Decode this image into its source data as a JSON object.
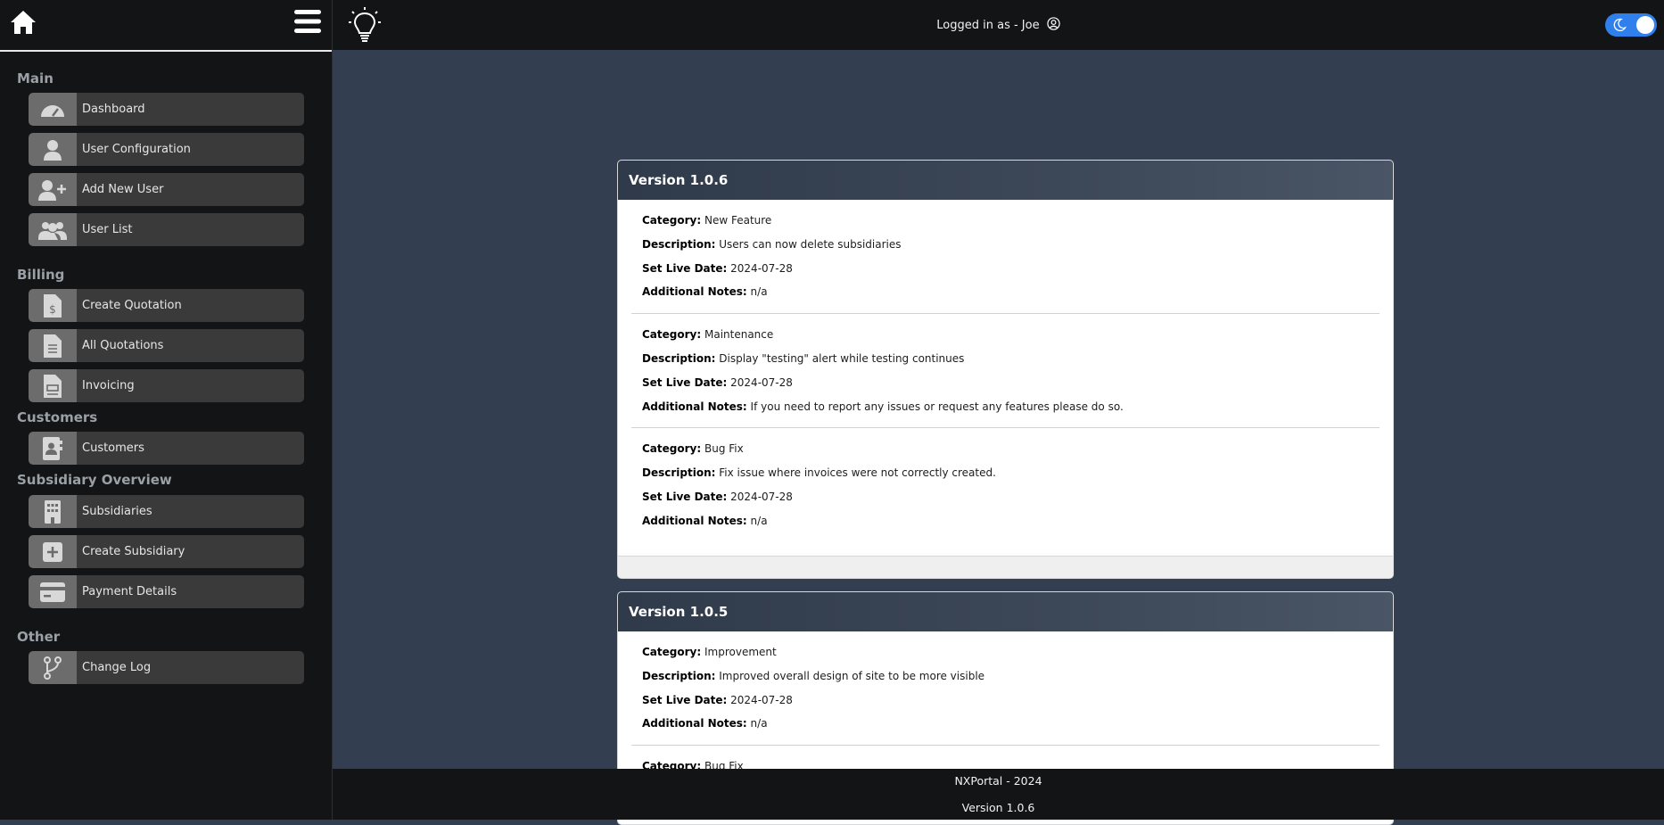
{
  "sidebar": {
    "sections": {
      "main": "Main",
      "billing": "Billing",
      "customers": "Customers",
      "subsidiary": "Subsidiary Overview",
      "other": "Other"
    },
    "items": {
      "dashboard": "Dashboard",
      "user_configuration": "User Configuration",
      "add_new_user": "Add New User",
      "user_list": "User List",
      "create_quotation": "Create Quotation",
      "all_quotations": "All Quotations",
      "invoicing": "Invoicing",
      "customers": "Customers",
      "subsidiaries": "Subsidiaries",
      "create_subsidiary": "Create Subsidiary",
      "payment_details": "Payment Details",
      "change_log": "Change Log"
    }
  },
  "header": {
    "login_text": "Logged in as - Joe"
  },
  "labels": {
    "category": "Category:",
    "description": "Description:",
    "set_live_date": "Set Live Date:",
    "additional_notes": "Additional Notes:"
  },
  "versions": [
    {
      "title": "Version 1.0.6",
      "entries": [
        {
          "category": "New Feature",
          "description": "Users can now delete subsidiaries",
          "date": "2024-07-28",
          "notes": "n/a"
        },
        {
          "category": "Maintenance",
          "description": "Display \"testing\" alert while testing continues",
          "date": "2024-07-28",
          "notes": "If you need to report any issues or request any features please do so."
        },
        {
          "category": "Bug Fix",
          "description": "Fix issue where invoices were not correctly created.",
          "date": "2024-07-28",
          "notes": "n/a"
        }
      ]
    },
    {
      "title": "Version 1.0.5",
      "entries": [
        {
          "category": "Improvement",
          "description": "Improved overall design of site to be more visible",
          "date": "2024-07-28",
          "notes": "n/a"
        },
        {
          "category": "Bug Fix",
          "description": "",
          "date": "",
          "notes": ""
        }
      ]
    }
  ],
  "footer": {
    "brand": "NXPortal - 2024",
    "version": "Version 1.0.6"
  },
  "colors": {
    "sidebar_bg": "#121416",
    "content_bg": "#333f51",
    "nav_item_bg": "#3a3a3a",
    "toggle_accent": "#2f80ed"
  }
}
